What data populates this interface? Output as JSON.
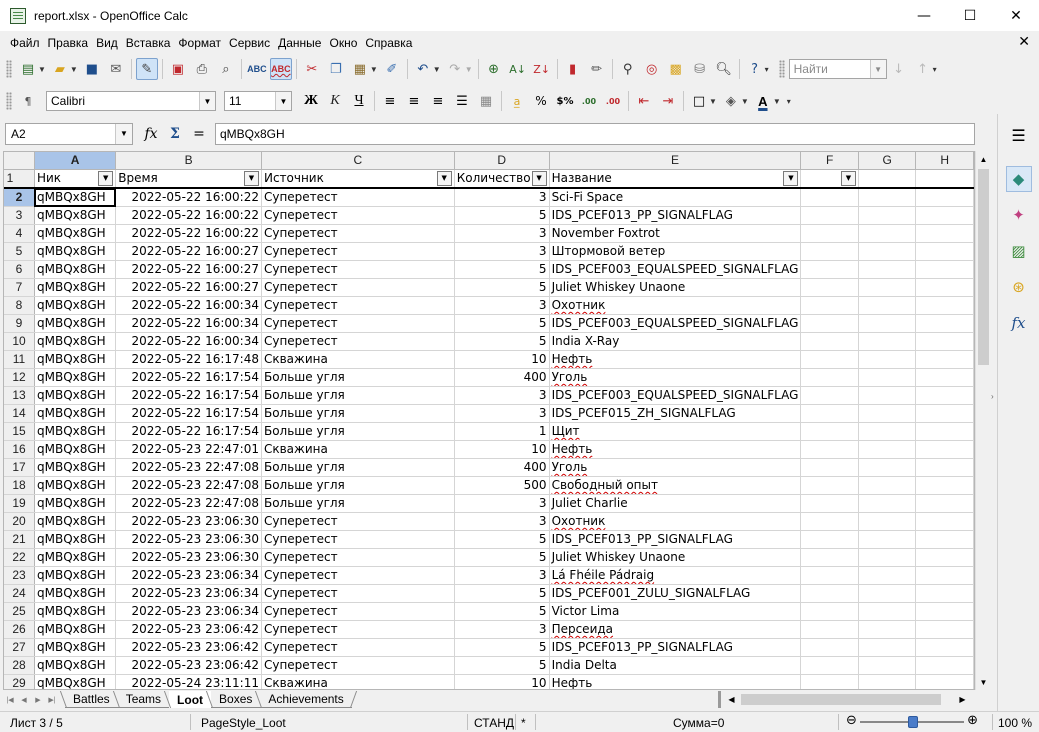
{
  "window": {
    "title": "report.xlsx - OpenOffice Calc",
    "minimize": "—",
    "maximize": "☐",
    "close": "✕",
    "doc_close": "✕"
  },
  "menu": [
    "Файл",
    "Правка",
    "Вид",
    "Вставка",
    "Формат",
    "Сервис",
    "Данные",
    "Окно",
    "Справка"
  ],
  "toolbar": {
    "find_placeholder": "Найти"
  },
  "format": {
    "font_name": "Calibri",
    "font_size": "11",
    "bold": "Ж",
    "italic": "К",
    "underline": "Ч"
  },
  "formula": {
    "cell_ref": "A2",
    "content": "qMBQx8GH",
    "fx": "fx",
    "sum": "Σ",
    "equals": "="
  },
  "columns": [
    "A",
    "B",
    "C",
    "D",
    "E",
    "F",
    "G",
    "H"
  ],
  "header_row": {
    "num": "1",
    "cells": [
      "Ник",
      "Время",
      "Источник",
      "Количество",
      "Название",
      "",
      "",
      ""
    ]
  },
  "rows": [
    {
      "n": "2",
      "nick": "qMBQx8GH",
      "time": "2022-05-22 16:00:22",
      "source": "Суперетест",
      "qty": "3",
      "name": "Sci-Fi Space"
    },
    {
      "n": "3",
      "nick": "qMBQx8GH",
      "time": "2022-05-22 16:00:22",
      "source": "Суперетест",
      "qty": "5",
      "name": "IDS_PCEF013_PP_SIGNALFLAG"
    },
    {
      "n": "4",
      "nick": "qMBQx8GH",
      "time": "2022-05-22 16:00:22",
      "source": "Суперетест",
      "qty": "3",
      "name": "November Foxtrot"
    },
    {
      "n": "5",
      "nick": "qMBQx8GH",
      "time": "2022-05-22 16:00:27",
      "source": "Суперетест",
      "qty": "3",
      "name": "Штормовой ветер"
    },
    {
      "n": "6",
      "nick": "qMBQx8GH",
      "time": "2022-05-22 16:00:27",
      "source": "Суперетест",
      "qty": "5",
      "name": "IDS_PCEF003_EQUALSPEED_SIGNALFLAG"
    },
    {
      "n": "7",
      "nick": "qMBQx8GH",
      "time": "2022-05-22 16:00:27",
      "source": "Суперетест",
      "qty": "5",
      "name": "Juliet Whiskey Unaone"
    },
    {
      "n": "8",
      "nick": "qMBQx8GH",
      "time": "2022-05-22 16:00:34",
      "source": "Суперетест",
      "qty": "3",
      "name": "Охотник"
    },
    {
      "n": "9",
      "nick": "qMBQx8GH",
      "time": "2022-05-22 16:00:34",
      "source": "Суперетест",
      "qty": "5",
      "name": "IDS_PCEF003_EQUALSPEED_SIGNALFLAG"
    },
    {
      "n": "10",
      "nick": "qMBQx8GH",
      "time": "2022-05-22 16:00:34",
      "source": "Суперетест",
      "qty": "5",
      "name": "India X-Ray"
    },
    {
      "n": "11",
      "nick": "qMBQx8GH",
      "time": "2022-05-22 16:17:48",
      "source": "Скважина",
      "qty": "10",
      "name": "Нефть"
    },
    {
      "n": "12",
      "nick": "qMBQx8GH",
      "time": "2022-05-22 16:17:54",
      "source": "Больше угля",
      "qty": "400",
      "name": "Уголь"
    },
    {
      "n": "13",
      "nick": "qMBQx8GH",
      "time": "2022-05-22 16:17:54",
      "source": "Больше угля",
      "qty": "3",
      "name": "IDS_PCEF003_EQUALSPEED_SIGNALFLAG"
    },
    {
      "n": "14",
      "nick": "qMBQx8GH",
      "time": "2022-05-22 16:17:54",
      "source": "Больше угля",
      "qty": "3",
      "name": "IDS_PCEF015_ZH_SIGNALFLAG"
    },
    {
      "n": "15",
      "nick": "qMBQx8GH",
      "time": "2022-05-22 16:17:54",
      "source": "Больше угля",
      "qty": "1",
      "name": "Щит"
    },
    {
      "n": "16",
      "nick": "qMBQx8GH",
      "time": "2022-05-23 22:47:01",
      "source": "Скважина",
      "qty": "10",
      "name": "Нефть"
    },
    {
      "n": "17",
      "nick": "qMBQx8GH",
      "time": "2022-05-23 22:47:08",
      "source": "Больше угля",
      "qty": "400",
      "name": "Уголь"
    },
    {
      "n": "18",
      "nick": "qMBQx8GH",
      "time": "2022-05-23 22:47:08",
      "source": "Больше угля",
      "qty": "500",
      "name": "Свободный опыт"
    },
    {
      "n": "19",
      "nick": "qMBQx8GH",
      "time": "2022-05-23 22:47:08",
      "source": "Больше угля",
      "qty": "3",
      "name": "Juliet Charlie"
    },
    {
      "n": "20",
      "nick": "qMBQx8GH",
      "time": "2022-05-23 23:06:30",
      "source": "Суперетест",
      "qty": "3",
      "name": "Охотник"
    },
    {
      "n": "21",
      "nick": "qMBQx8GH",
      "time": "2022-05-23 23:06:30",
      "source": "Суперетест",
      "qty": "5",
      "name": "IDS_PCEF013_PP_SIGNALFLAG"
    },
    {
      "n": "22",
      "nick": "qMBQx8GH",
      "time": "2022-05-23 23:06:30",
      "source": "Суперетест",
      "qty": "5",
      "name": "Juliet Whiskey Unaone"
    },
    {
      "n": "23",
      "nick": "qMBQx8GH",
      "time": "2022-05-23 23:06:34",
      "source": "Суперетест",
      "qty": "3",
      "name": "Lá Fhéile Pádraig"
    },
    {
      "n": "24",
      "nick": "qMBQx8GH",
      "time": "2022-05-23 23:06:34",
      "source": "Суперетест",
      "qty": "5",
      "name": "IDS_PCEF001_ZULU_SIGNALFLAG"
    },
    {
      "n": "25",
      "nick": "qMBQx8GH",
      "time": "2022-05-23 23:06:34",
      "source": "Суперетест",
      "qty": "5",
      "name": "Victor Lima"
    },
    {
      "n": "26",
      "nick": "qMBQx8GH",
      "time": "2022-05-23 23:06:42",
      "source": "Суперетест",
      "qty": "3",
      "name": "Персеида"
    },
    {
      "n": "27",
      "nick": "qMBQx8GH",
      "time": "2022-05-23 23:06:42",
      "source": "Суперетест",
      "qty": "5",
      "name": "IDS_PCEF013_PP_SIGNALFLAG"
    },
    {
      "n": "28",
      "nick": "qMBQx8GH",
      "time": "2022-05-23 23:06:42",
      "source": "Суперетест",
      "qty": "5",
      "name": "India Delta"
    },
    {
      "n": "29",
      "nick": "qMBQx8GH",
      "time": "2022-05-24 23:11:11",
      "source": "Скважина",
      "qty": "10",
      "name": "Нефть"
    }
  ],
  "sheets": [
    "Battles",
    "Teams",
    "Loot",
    "Boxes",
    "Achievements"
  ],
  "status": {
    "sheet": "Лист 3 / 5",
    "page_style": "PageStyle_Loot",
    "mode": "СТАНД",
    "modified": "*",
    "sum": "Сумма=0",
    "zoom": "100 %"
  }
}
